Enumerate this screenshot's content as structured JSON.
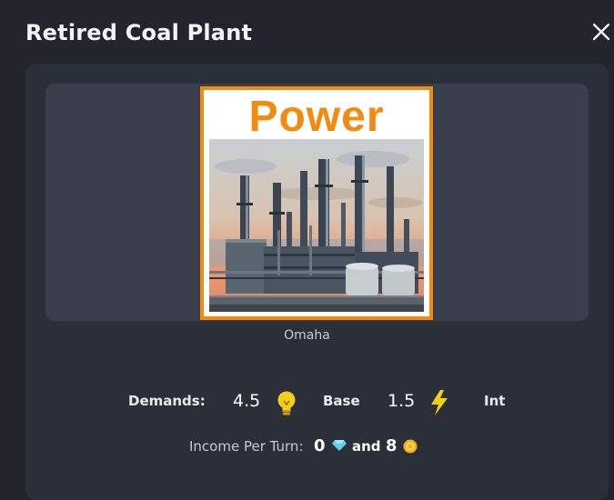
{
  "dialog": {
    "title": "Retired Coal Plant",
    "close_icon": "close-icon"
  },
  "card": {
    "label": "Power",
    "image": "industrial-power-plant-illustration",
    "accent_color": "#f28c11"
  },
  "location": "Omaha",
  "stats": {
    "demands_label": "Demands:",
    "demands_value": "4.5",
    "demands_icon": "lightbulb-icon",
    "base_label": "Base",
    "base_value": "1.5",
    "base_icon": "lightning-bolt-icon",
    "int_label": "Int"
  },
  "income": {
    "label": "Income Per Turn:",
    "gem_value": "0",
    "gem_icon": "gem-icon",
    "and_label": "and",
    "coin_value": "8",
    "coin_icon": "coin-icon"
  }
}
